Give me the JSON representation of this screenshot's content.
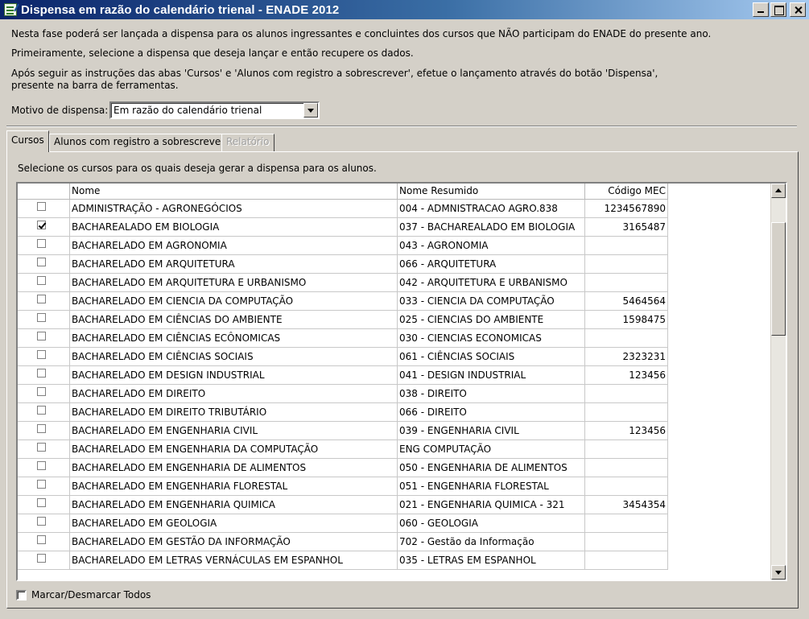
{
  "window": {
    "title": "Dispensa em razão do calendário trienal - ENADE 2012"
  },
  "instructions": {
    "line1": "Nesta fase poderá ser lançada a dispensa para os alunos ingressantes e concluintes dos cursos que NÃO participam do ENADE do presente ano.",
    "line2": "Primeiramente, selecione a dispensa que deseja lançar e então recupere os dados.",
    "line3a": "Após seguir as instruções das abas 'Cursos' e 'Alunos com registro a sobrescrever', efetue o lançamento através do botão 'Dispensa',",
    "line3b": "presente na barra de ferramentas."
  },
  "motivo": {
    "label": "Motivo de dispensa:",
    "value": "Em razão do calendário trienal"
  },
  "tabs": [
    {
      "label": "Cursos",
      "state": "active"
    },
    {
      "label": "Alunos com registro a sobrescrever",
      "state": "normal"
    },
    {
      "label": "Relatório",
      "state": "disabled"
    }
  ],
  "panel": {
    "hint": "Selecione os cursos para os quais deseja gerar a dispensa para os alunos."
  },
  "grid": {
    "columns": [
      "",
      "Nome",
      "Nome Resumido",
      "Código MEC"
    ],
    "rows": [
      {
        "checked": false,
        "nome": "ADMINISTRAÇÃO - AGRONEGÓCIOS",
        "resumido": "004 - ADMNISTRACAO AGRO.838",
        "mec": "1234567890"
      },
      {
        "checked": true,
        "nome": "BACHAREALADO EM BIOLOGIA",
        "resumido": "037 - BACHAREALADO EM BIOLOGIA",
        "mec": "3165487"
      },
      {
        "checked": false,
        "nome": "BACHARELADO EM AGRONOMIA",
        "resumido": "043 - AGRONOMIA",
        "mec": ""
      },
      {
        "checked": false,
        "nome": "BACHARELADO EM ARQUITETURA",
        "resumido": "066 - ARQUITETURA",
        "mec": ""
      },
      {
        "checked": false,
        "nome": "BACHARELADO EM ARQUITETURA E URBANISMO",
        "resumido": "042 - ARQUITETURA E URBANISMO",
        "mec": ""
      },
      {
        "checked": false,
        "nome": "BACHARELADO EM CIENCIA DA COMPUTAÇÃO",
        "resumido": "033 - CIENCIA DA COMPUTAÇÃO",
        "mec": "5464564"
      },
      {
        "checked": false,
        "nome": "BACHARELADO EM CIÊNCIAS DO AMBIENTE",
        "resumido": "025 - CIENCIAS DO AMBIENTE",
        "mec": "1598475"
      },
      {
        "checked": false,
        "nome": "BACHARELADO EM CIÊNCIAS ECÔNOMICAS",
        "resumido": "030 - CIENCIAS ECONOMICAS",
        "mec": ""
      },
      {
        "checked": false,
        "nome": "BACHARELADO EM CIÊNCIAS SOCIAIS",
        "resumido": "061 - CIÊNCIAS SOCIAIS",
        "mec": "2323231"
      },
      {
        "checked": false,
        "nome": "BACHARELADO EM DESIGN INDUSTRIAL",
        "resumido": "041 - DESIGN INDUSTRIAL",
        "mec": "123456"
      },
      {
        "checked": false,
        "nome": "BACHARELADO EM DIREITO",
        "resumido": "038 - DIREITO",
        "mec": ""
      },
      {
        "checked": false,
        "nome": "BACHARELADO EM DIREITO TRIBUTÁRIO",
        "resumido": "066 - DIREITO",
        "mec": ""
      },
      {
        "checked": false,
        "nome": "BACHARELADO EM ENGENHARIA CIVIL",
        "resumido": "039 - ENGENHARIA CIVIL",
        "mec": "123456"
      },
      {
        "checked": false,
        "nome": "BACHARELADO EM ENGENHARIA DA COMPUTAÇÃO",
        "resumido": "ENG COMPUTAÇÃO",
        "mec": ""
      },
      {
        "checked": false,
        "nome": "BACHARELADO EM ENGENHARIA DE ALIMENTOS",
        "resumido": "050 - ENGENHARIA DE ALIMENTOS",
        "mec": ""
      },
      {
        "checked": false,
        "nome": "BACHARELADO EM ENGENHARIA FLORESTAL",
        "resumido": "051 - ENGENHARIA FLORESTAL",
        "mec": ""
      },
      {
        "checked": false,
        "nome": "BACHARELADO EM ENGENHARIA QUIMICA",
        "resumido": "021 - ENGENHARIA QUIMICA - 321",
        "mec": "3454354"
      },
      {
        "checked": false,
        "nome": "BACHARELADO EM GEOLOGIA",
        "resumido": "060 - GEOLOGIA",
        "mec": ""
      },
      {
        "checked": false,
        "nome": "BACHARELADO EM GESTÃO DA INFORMAÇÃO",
        "resumido": "702 - Gestão da Informação",
        "mec": ""
      },
      {
        "checked": false,
        "nome": "BACHARELADO EM LETRAS VERNÁCULAS EM ESPANHOL",
        "resumido": "035 - LETRAS EM ESPANHOL",
        "mec": ""
      }
    ]
  },
  "mark_all": {
    "label": "Marcar/Desmarcar Todos",
    "checked": false
  },
  "icons": {
    "app": "table-check-icon",
    "minimize": "minimize-icon",
    "maximize": "maximize-icon",
    "close": "close-icon"
  }
}
